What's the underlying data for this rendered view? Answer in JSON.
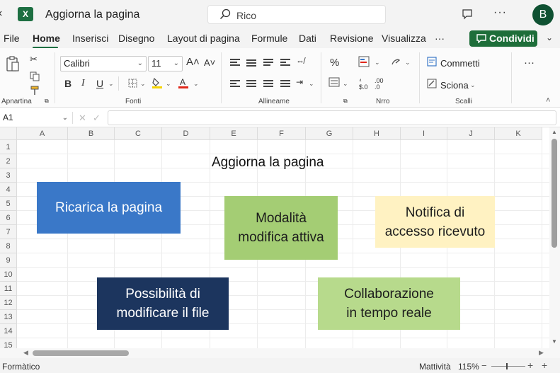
{
  "titlebar": {
    "doc_title": "Aggiorna la pagina",
    "search_text": "Rico",
    "avatar": "B"
  },
  "tabs": [
    {
      "label": "File"
    },
    {
      "label": "Home"
    },
    {
      "label": "Inserisci"
    },
    {
      "label": "Disegno"
    },
    {
      "label": "Layout di pagina"
    },
    {
      "label": "Formule"
    },
    {
      "label": "Dati"
    },
    {
      "label": "Revisione"
    },
    {
      "label": "Visualizza"
    },
    {
      "label": "···"
    }
  ],
  "share_label": "Condividi",
  "ribbon": {
    "font_name": "Calibri",
    "font_size": "11",
    "bold": "B",
    "italic": "I",
    "underline": "U",
    "grow_font": "A˄",
    "shrink_font": "A˅",
    "percent": "%",
    "comments": "Commetti",
    "scroll": "Sciona",
    "more": "···",
    "groups": {
      "clipboard": "Apnartina",
      "font": "Fonti",
      "alignment": "Allineame",
      "number": "Nrro",
      "cells": "Scalli"
    }
  },
  "formula_bar": {
    "name_box": "A1"
  },
  "grid": {
    "columns": [
      "A",
      "B",
      "C",
      "D",
      "E",
      "F",
      "G",
      "H",
      "I",
      "J",
      "K"
    ],
    "rows": [
      "1",
      "2",
      "3",
      "4",
      "5",
      "6",
      "7",
      "8",
      "9",
      "10",
      "11",
      "12",
      "13",
      "14",
      "15"
    ]
  },
  "sheet": {
    "title": "Aggiorna la pagina",
    "boxes": [
      {
        "lines": [
          "Ricarica la pagina"
        ],
        "color": "#3a78c8"
      },
      {
        "lines": [
          "Modalità",
          "modifica attiva"
        ],
        "color": "#a4cd74"
      },
      {
        "lines": [
          "Notifica di",
          "accesso ricevuto"
        ],
        "color": "#fff2c2"
      },
      {
        "lines": [
          "Possibilità di",
          "modificare il file"
        ],
        "color": "#1c355e"
      },
      {
        "lines": [
          "Collaborazione",
          "in tempo reale"
        ],
        "color": "#b7da8c"
      }
    ]
  },
  "status": {
    "left": "Formàtico",
    "activity": "Mattività",
    "zoom": "115%"
  },
  "colors": {
    "brand": "#1d6f42",
    "share": "#1e6e3a"
  }
}
